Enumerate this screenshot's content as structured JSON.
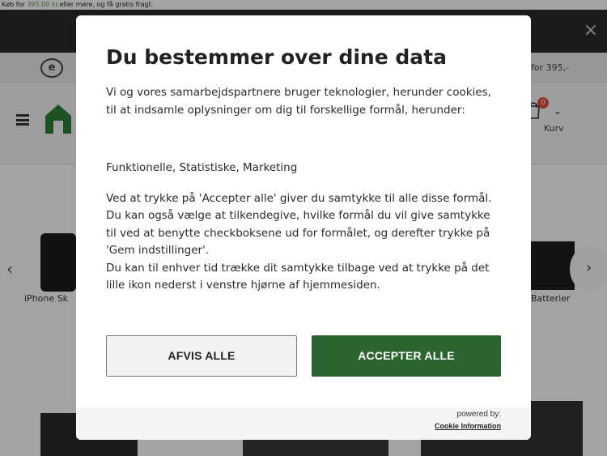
{
  "promo": {
    "text_before": "Køb for ",
    "price": "395,00 kr.",
    "text_after": "eller mere, og få gratis fragt."
  },
  "usp": {
    "emark_icon": "e-mark-icon",
    "right_text": "for 395,-"
  },
  "header": {
    "cart_badge": "0",
    "cart_label": "Kurv"
  },
  "carousel": {
    "left_product_label": "iPhone Sk",
    "right_product_label": "Batterier"
  },
  "consent": {
    "title": "Du bestemmer over dine data",
    "intro": "Vi og vores samarbejdspartnere bruger teknologier, herunder cookies, til at indsamle oplysninger om dig til forskellige formål, herunder:",
    "purposes": "Funktionelle, Statistiske, Marketing",
    "details_1": "Ved at trykke på 'Accepter alle' giver du samtykke til alle disse formål. Du kan også vælge at tilkendegive, hvilke formål du vil give samtykke til ved at benytte checkboksene ud for formålet, og derefter trykke på 'Gem indstillinger'.",
    "details_2": "Du kan til enhver tid trække dit samtykke tilbage ved at trykke på det lille ikon nederst i venstre hjørne af hjemmesiden.",
    "reject_label": "AFVIS ALLE",
    "accept_label": "ACCEPTER ALLE",
    "powered_by": "powered by:",
    "provider": "Cookie Information"
  },
  "colors": {
    "accept_green": "#2c6530",
    "topbar_dark": "#2a2a2a",
    "overlay": "rgba(0,0,0,0.36)"
  }
}
